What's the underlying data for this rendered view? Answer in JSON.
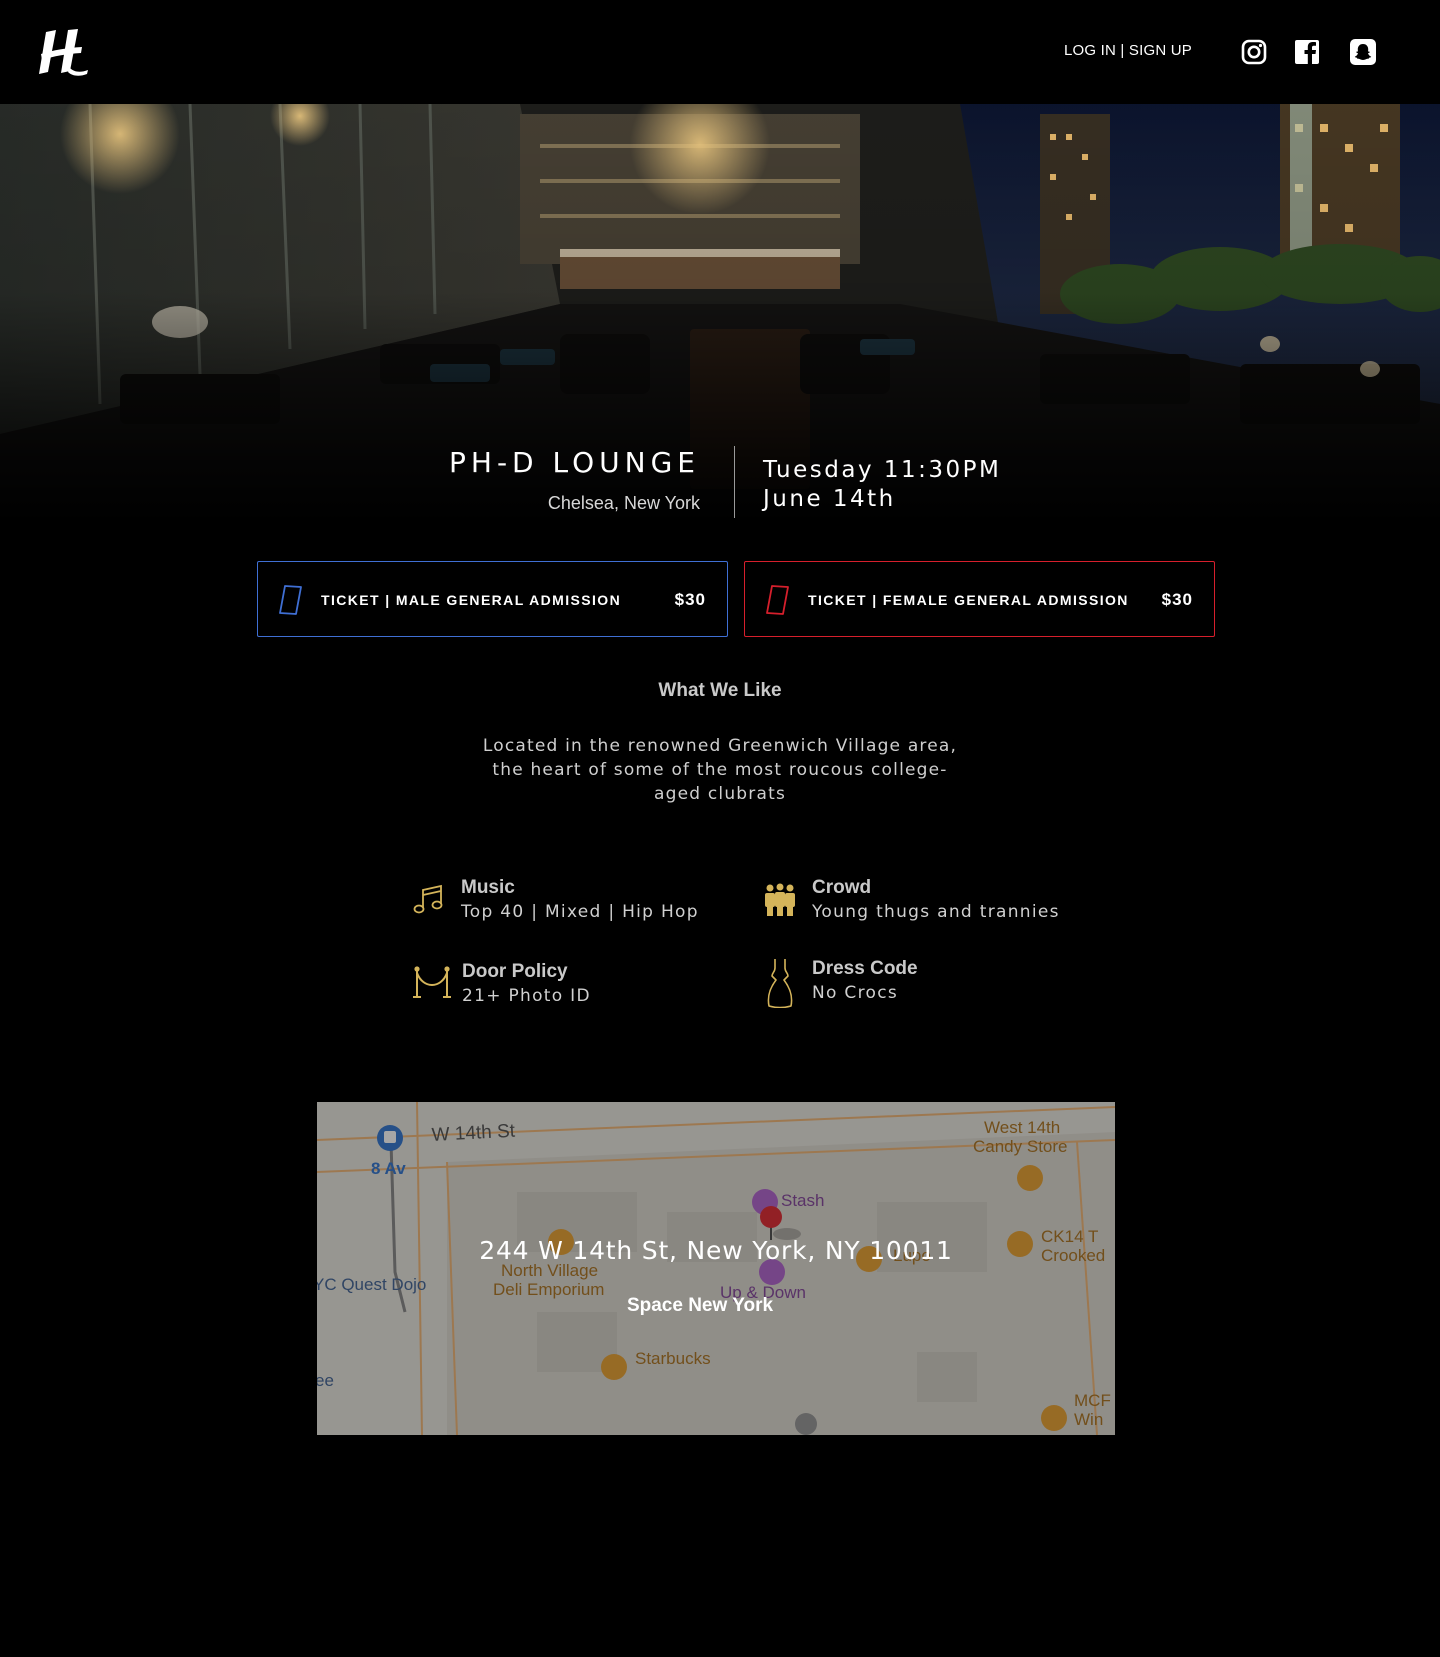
{
  "header": {
    "auth_link": "LOG IN | SIGN UP",
    "social": [
      "instagram-icon",
      "facebook-icon",
      "snapchat-icon"
    ]
  },
  "event": {
    "venue_name": "PH-D LOUNGE",
    "location": "Chelsea, New York",
    "date_line1": "Tuesday 11:30PM",
    "date_line2": "June 14th"
  },
  "tickets": [
    {
      "label": "TICKET | MALE GENERAL ADMISSION",
      "price": "$30",
      "color": "#3f6fd4",
      "icon": "ticket-icon"
    },
    {
      "label": "TICKET | FEMALE GENERAL ADMISSION",
      "price": "$30",
      "color": "#d61f2c",
      "icon": "ticket-icon"
    }
  ],
  "what_we_like": {
    "title": "What We Like",
    "description": "Located in the renowned Greenwich Village area, the heart of some of the most roucous college-aged clubrats"
  },
  "features": [
    {
      "title": "Music",
      "value": "Top 40 | Mixed | Hip Hop",
      "icon": "music-note-icon"
    },
    {
      "title": "Crowd",
      "value": "Young thugs and trannies",
      "icon": "crowd-icon"
    },
    {
      "title": "Door Policy",
      "value": "21+ Photo ID",
      "icon": "velvet-rope-icon"
    },
    {
      "title": "Dress Code",
      "value": "No Crocs",
      "icon": "dress-icon"
    }
  ],
  "map": {
    "address": "244 W 14th St, New York, NY 10011",
    "venue": "Space New York",
    "street_labels": [
      "W 14th St"
    ],
    "transit_labels": [
      "8 Av"
    ],
    "poi_labels": [
      "West 14th",
      "Candy Store",
      "Stash",
      "North Village",
      "Deli Emporium",
      "Starbucks",
      "CK14 T",
      "Crooked",
      "YC Quest Dojo",
      "Up & Down",
      "ee",
      "MCF",
      "Win",
      "Lupo"
    ]
  },
  "colors": {
    "background": "#000000",
    "male_accent": "#3f6fd4",
    "female_accent": "#d61f2c",
    "icon_gold": "#d4b45a"
  }
}
